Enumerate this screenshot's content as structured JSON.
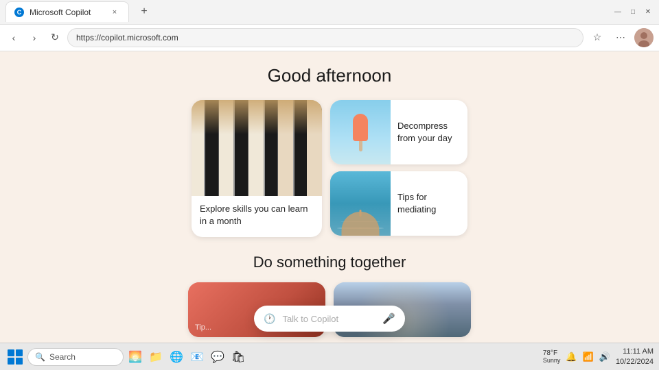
{
  "browser": {
    "tab_title": "Microsoft Copilot",
    "tab_favicon": "C",
    "address": "https://copilot.microsoft.com",
    "new_tab_label": "+",
    "close_tab": "×",
    "nav": {
      "back": "‹",
      "forward": "›",
      "refresh": "↻"
    },
    "toolbar": {
      "favorites": "☆",
      "extensions": "⋯",
      "copilot": "◉"
    }
  },
  "page": {
    "greeting": "Good afternoon",
    "card_large": {
      "text": "Explore skills you can learn in a month"
    },
    "card_small_1": {
      "text": "Decompress from your day"
    },
    "card_small_2": {
      "text": "Tips for mediating"
    },
    "section2_title": "Do something together",
    "bottom_card_1_label": "Tip...",
    "bottom_card_2_label": "",
    "search_placeholder": "Talk to Copilot"
  },
  "taskbar": {
    "search_placeholder": "Search",
    "time": "11:11 AM",
    "date": "10/22/2024",
    "weather": "78°F",
    "weather_condition": "Sunny"
  }
}
